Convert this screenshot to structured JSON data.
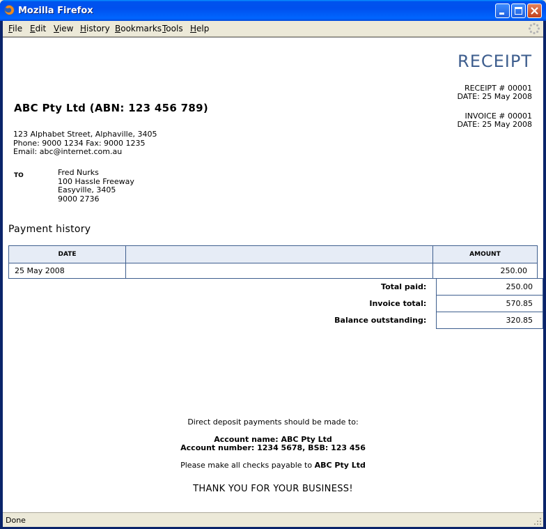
{
  "window": {
    "title": "Mozilla Firefox",
    "icons": {
      "app": "firefox-icon",
      "minimize": "minimize-icon",
      "maximize": "maximize-icon",
      "close": "close-icon",
      "throbber": "throbber-icon",
      "resize_grip": "resize-grip-icon"
    }
  },
  "menubar": {
    "items": [
      {
        "accel": "F",
        "rest": "ile"
      },
      {
        "accel": "E",
        "rest": "dit"
      },
      {
        "accel": "V",
        "rest": "iew"
      },
      {
        "accel": "H",
        "rest": "istory"
      },
      {
        "accel": "B",
        "rest": "ookmarks"
      },
      {
        "accel": "T",
        "rest": "ools"
      },
      {
        "accel": "H",
        "rest": "elp"
      }
    ]
  },
  "receipt": {
    "heading": "RECEIPT",
    "receipt_number": "RECEIPT # 00001",
    "receipt_date": "DATE: 25 May 2008",
    "invoice_number": "INVOICE # 00001",
    "invoice_date": "DATE: 25 May 2008"
  },
  "company": {
    "name": "ABC Pty Ltd (ABN: 123 456 789)",
    "street": "123 Alphabet Street, Alphaville, 3405",
    "phone_fax": "Phone: 9000 1234 Fax: 9000 1235",
    "email": "Email: abc@internet.com.au"
  },
  "to": {
    "label": "TO",
    "name": "Fred Nurks",
    "street": "100 Hassle Freeway",
    "city": "Easyville, 3405",
    "phone": "9000 2736"
  },
  "payment_history": {
    "title": "Payment history",
    "columns": [
      "DATE",
      "",
      "AMOUNT"
    ],
    "rows": [
      {
        "date": "25 May 2008",
        "description": "",
        "amount": "250.00"
      }
    ],
    "totals": [
      {
        "label": "Total paid:",
        "value": "250.00"
      },
      {
        "label": "Invoice total:",
        "value": "570.85"
      },
      {
        "label": "Balance outstanding:",
        "value": "320.85"
      }
    ]
  },
  "footer": {
    "deposit_intro": "Direct deposit payments should be made to:",
    "account_name": "Account name: ABC Pty Ltd",
    "account_number": "Account number: 1234 5678, BSB: 123 456",
    "checks_prefix": "Please make all checks payable to ",
    "checks_payee": "ABC Pty Ltd",
    "thanks": "THANK YOU FOR YOUR BUSINESS!"
  },
  "status": {
    "text": "Done"
  }
}
